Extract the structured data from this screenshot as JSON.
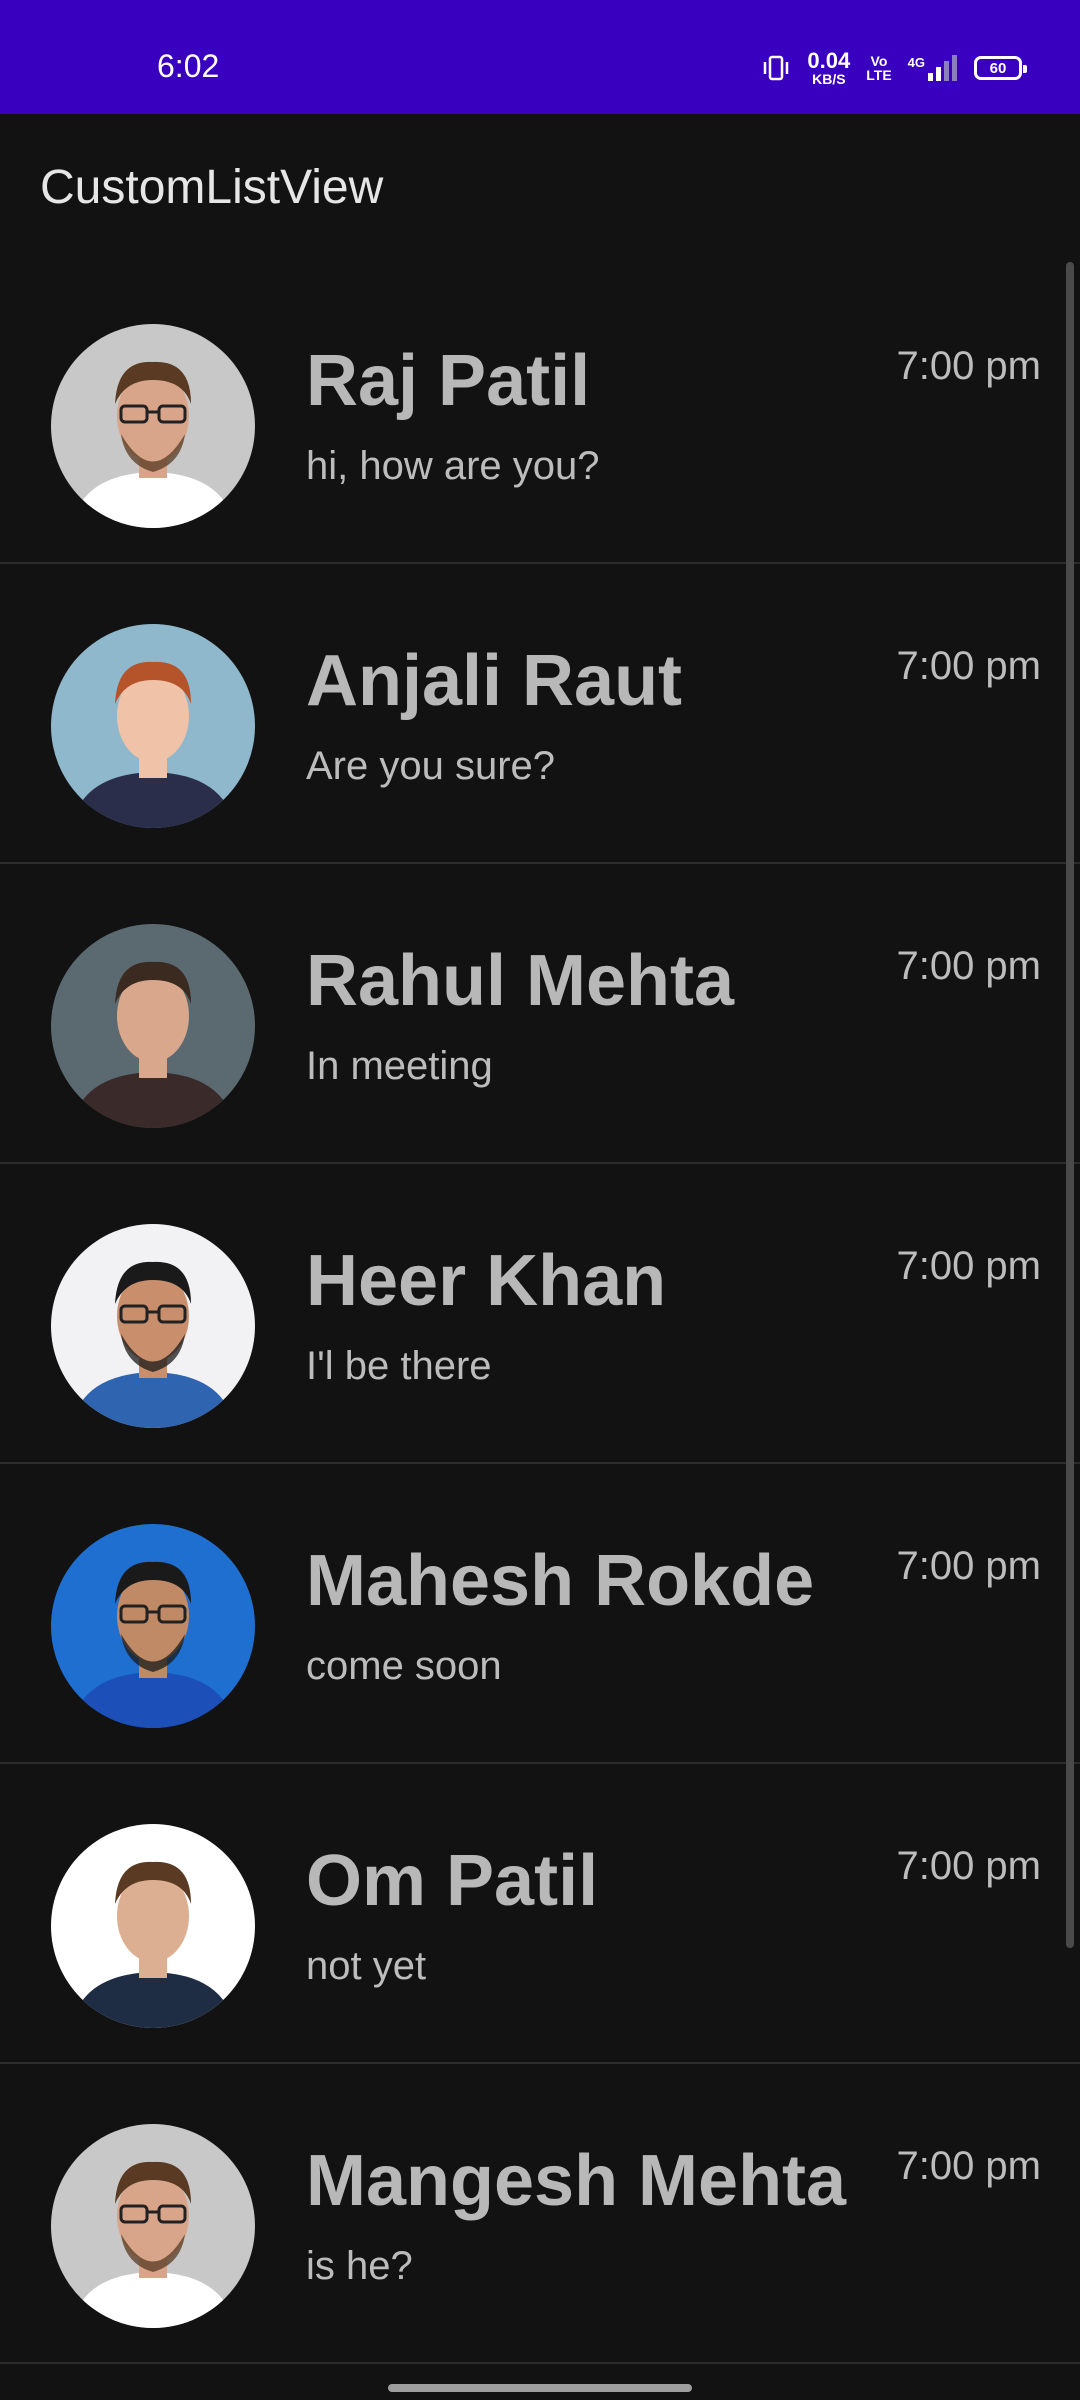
{
  "status_bar": {
    "time": "6:02",
    "net_speed_value": "0.04",
    "net_speed_unit": "KB/S",
    "volte_top": "Vo",
    "volte_bottom": "LTE",
    "network": "4G",
    "battery": "60",
    "background_color": "#3a00c0"
  },
  "app_bar": {
    "title": "CustomListView"
  },
  "contacts": [
    {
      "name": "Raj Patil",
      "message": "hi, how are you?",
      "time": "7:00 pm",
      "avatar_bg": "#c8c8c8",
      "avatar_skin": "#d8a58a",
      "avatar_hair": "#5a3a22",
      "avatar_shirt": "#ffffff",
      "glasses": true,
      "beard": true
    },
    {
      "name": "Anjali Raut",
      "message": "Are you sure?",
      "time": "7:00 pm",
      "avatar_bg": "#8fb8cc",
      "avatar_skin": "#f0c2a8",
      "avatar_hair": "#b5532a",
      "avatar_shirt": "#2a2e4a",
      "glasses": false,
      "beard": false
    },
    {
      "name": "Rahul Mehta",
      "message": "In meeting",
      "time": "7:00 pm",
      "avatar_bg": "#5a6a70",
      "avatar_skin": "#d9a88c",
      "avatar_hair": "#3b2a20",
      "avatar_shirt": "#3a2a2a",
      "glasses": false,
      "beard": false
    },
    {
      "name": "Heer Khan",
      "message": "I'l be there",
      "time": "7:00 pm",
      "avatar_bg": "#f2f2f4",
      "avatar_skin": "#c98f6c",
      "avatar_hair": "#1a1a1a",
      "avatar_shirt": "#2f64b0",
      "glasses": true,
      "beard": true
    },
    {
      "name": "Mahesh Rokde",
      "message": "come soon",
      "time": "7:00 pm",
      "avatar_bg": "#1f6fd0",
      "avatar_skin": "#c08a66",
      "avatar_hair": "#1a1a1a",
      "avatar_shirt": "#1c4fb8",
      "glasses": true,
      "beard": true
    },
    {
      "name": "Om Patil",
      "message": "not yet",
      "time": "7:00 pm",
      "avatar_bg": "#ffffff",
      "avatar_skin": "#dcae92",
      "avatar_hair": "#5a3a22",
      "avatar_shirt": "#1f2d44",
      "glasses": false,
      "beard": false
    },
    {
      "name": "Mangesh Mehta",
      "message": "is he?",
      "time": "7:00 pm",
      "avatar_bg": "#c8c8c8",
      "avatar_skin": "#d8a58a",
      "avatar_hair": "#5a3a22",
      "avatar_shirt": "#ffffff",
      "glasses": true,
      "beard": true
    }
  ],
  "icons": {
    "vibrate": "vibrate-icon",
    "signal": "signal-icon",
    "battery": "battery-icon"
  }
}
